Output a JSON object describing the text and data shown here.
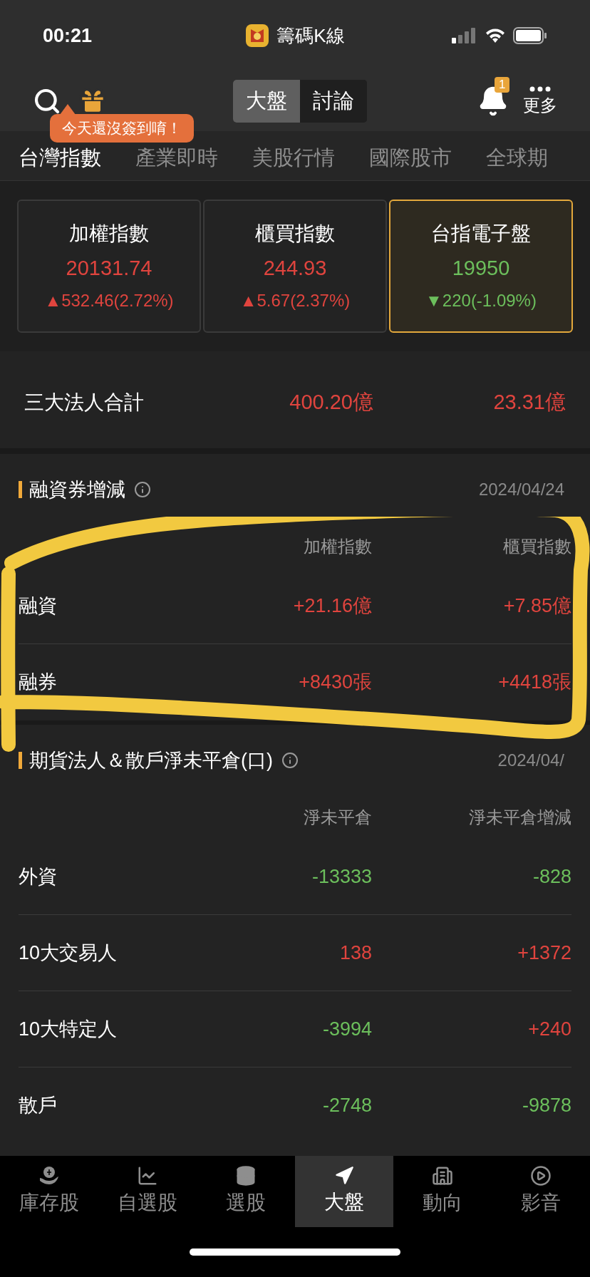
{
  "status_bar": {
    "time": "00:21",
    "app_name": "籌碼K線"
  },
  "header": {
    "segments": [
      {
        "label": "大盤",
        "selected": true
      },
      {
        "label": "討論",
        "selected": false
      }
    ],
    "notification_count": "1",
    "more_label": "更多",
    "tooltip": "今天還沒簽到唷！"
  },
  "tabs": [
    {
      "label": "台灣指數",
      "selected": true
    },
    {
      "label": "產業即時",
      "selected": false
    },
    {
      "label": "美股行情",
      "selected": false
    },
    {
      "label": "國際股市",
      "selected": false
    },
    {
      "label": "全球期",
      "selected": false
    }
  ],
  "index_cards": [
    {
      "name": "加權指數",
      "value": "20131.74",
      "change": "▲532.46(2.72%)",
      "color": "#e0443e",
      "selected": false
    },
    {
      "name": "櫃買指數",
      "value": "244.93",
      "change": "▲5.67(2.37%)",
      "color": "#e0443e",
      "selected": false
    },
    {
      "name": "台指電子盤",
      "value": "19950",
      "change": "▼220(-1.09%)",
      "color": "#6cbf5c",
      "selected": true
    }
  ],
  "institutional_total": {
    "label": "三大法人合計",
    "values": [
      {
        "text": "400.20億",
        "color": "#e0443e"
      },
      {
        "text": "23.31億",
        "color": "#e0443e"
      }
    ]
  },
  "margin_section": {
    "title": "融資券增減",
    "date": "2024/04/24",
    "columns": [
      "加權指數",
      "櫃買指數"
    ],
    "rows": [
      {
        "label": "融資",
        "values": [
          {
            "text": "+21.16億",
            "color": "#e0443e"
          },
          {
            "text": "+7.85億",
            "color": "#e0443e"
          }
        ]
      },
      {
        "label": "融券",
        "values": [
          {
            "text": "+8430張",
            "color": "#e0443e"
          },
          {
            "text": "+4418張",
            "color": "#e0443e"
          }
        ]
      }
    ]
  },
  "futures_section": {
    "title": "期貨法人＆散戶淨未平倉(口)",
    "date": "2024/04/",
    "columns": [
      "淨未平倉",
      "淨未平倉增減"
    ],
    "rows": [
      {
        "label": "外資",
        "values": [
          {
            "text": "-13333",
            "color": "#6cbf5c"
          },
          {
            "text": "-828",
            "color": "#6cbf5c"
          }
        ]
      },
      {
        "label": "10大交易人",
        "values": [
          {
            "text": "138",
            "color": "#e0443e"
          },
          {
            "text": "+1372",
            "color": "#e0443e"
          }
        ]
      },
      {
        "label": "10大特定人",
        "values": [
          {
            "text": "-3994",
            "color": "#6cbf5c"
          },
          {
            "text": "+240",
            "color": "#e0443e"
          }
        ]
      },
      {
        "label": "散戶",
        "values": [
          {
            "text": "-2748",
            "color": "#6cbf5c"
          },
          {
            "text": "-9878",
            "color": "#6cbf5c"
          }
        ]
      }
    ]
  },
  "bottom_nav": [
    {
      "label": "庫存股",
      "selected": false
    },
    {
      "label": "自選股",
      "selected": false
    },
    {
      "label": "選股",
      "selected": false
    },
    {
      "label": "大盤",
      "selected": true
    },
    {
      "label": "動向",
      "selected": false
    },
    {
      "label": "影音",
      "selected": false
    }
  ]
}
